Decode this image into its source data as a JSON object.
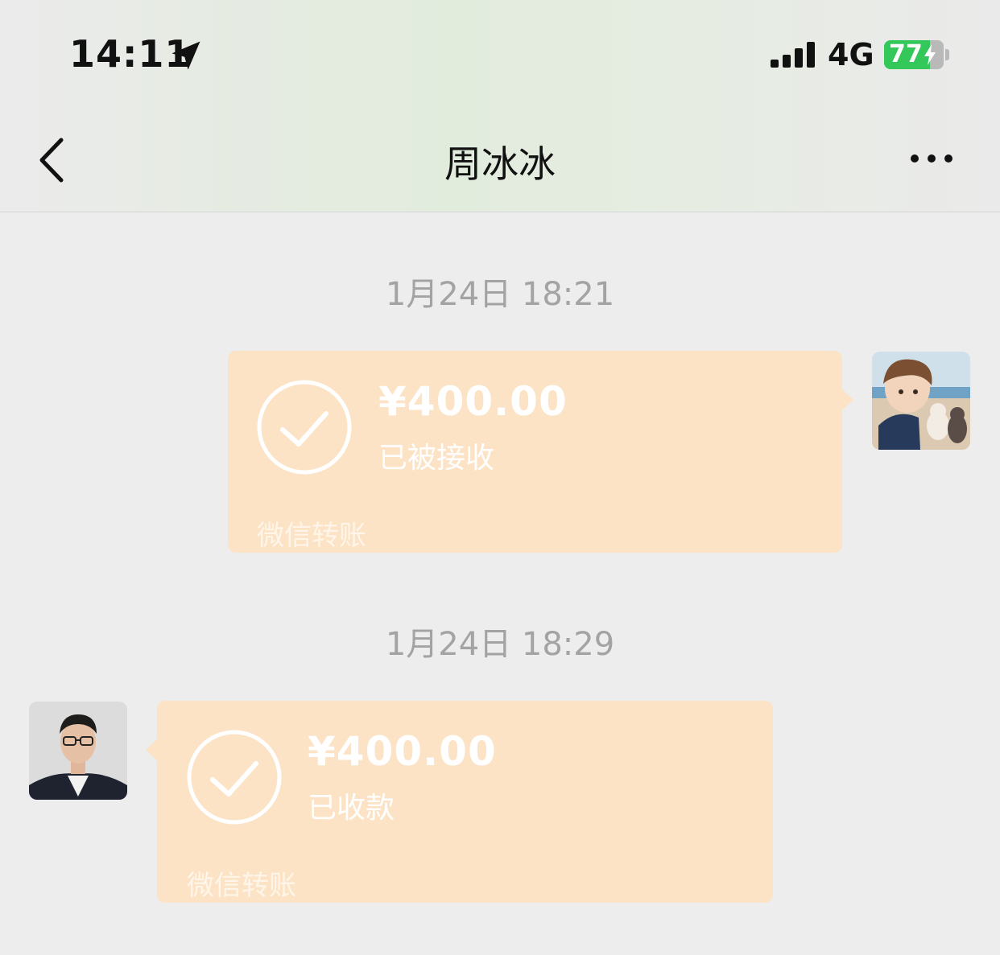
{
  "status_bar": {
    "time": "14:11",
    "network": "4G",
    "battery": "77",
    "battery_level": 0.77
  },
  "nav": {
    "title": "周冰冰"
  },
  "messages": [
    {
      "timestamp": "1月24日 18:21",
      "direction": "outgoing",
      "amount": "¥400.00",
      "status": "已被接收",
      "label": "微信转账"
    },
    {
      "timestamp": "1月24日 18:29",
      "direction": "incoming",
      "amount": "¥400.00",
      "status": "已收款",
      "label": "微信转账"
    }
  ],
  "colors": {
    "bubble": "#fce3c6",
    "background": "#ededed",
    "battery": "#34c759"
  }
}
